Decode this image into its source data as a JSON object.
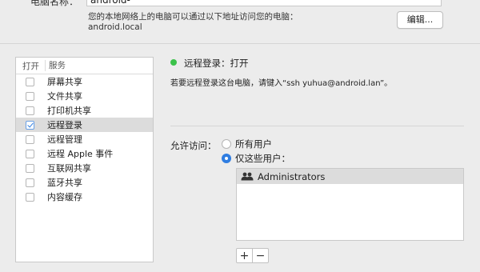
{
  "computer_name": {
    "label": "电脑名称：",
    "value": "android-",
    "access_note_line1": "您的本地网络上的电脑可以通过以下地址访问您的电脑：",
    "access_note_line2": "android.local",
    "edit_button": "编辑..."
  },
  "services": {
    "header_open": "打开",
    "header_service": "服务",
    "items": [
      {
        "label": "屏幕共享",
        "checked": false,
        "selected": false
      },
      {
        "label": "文件共享",
        "checked": false,
        "selected": false
      },
      {
        "label": "打印机共享",
        "checked": false,
        "selected": false
      },
      {
        "label": "远程登录",
        "checked": true,
        "selected": true
      },
      {
        "label": "远程管理",
        "checked": false,
        "selected": false
      },
      {
        "label": "远程 Apple 事件",
        "checked": false,
        "selected": false
      },
      {
        "label": "互联网共享",
        "checked": false,
        "selected": false
      },
      {
        "label": "蓝牙共享",
        "checked": false,
        "selected": false
      },
      {
        "label": "内容缓存",
        "checked": false,
        "selected": false
      }
    ]
  },
  "detail": {
    "status_text": "远程登录：打开",
    "status_color": "#3bc24a",
    "hint": "若要远程登录这台电脑，请键入“ssh yuhua@android.lan”。",
    "allow_access_label": "允许访问：",
    "option_all": "所有用户",
    "option_only": "仅这些用户：",
    "selected_option": "only",
    "users": [
      "Administrators"
    ],
    "add_label": "+",
    "remove_label": "−"
  },
  "colors": {
    "accent": "#2f7de1",
    "selection": "#dcdcdc"
  }
}
